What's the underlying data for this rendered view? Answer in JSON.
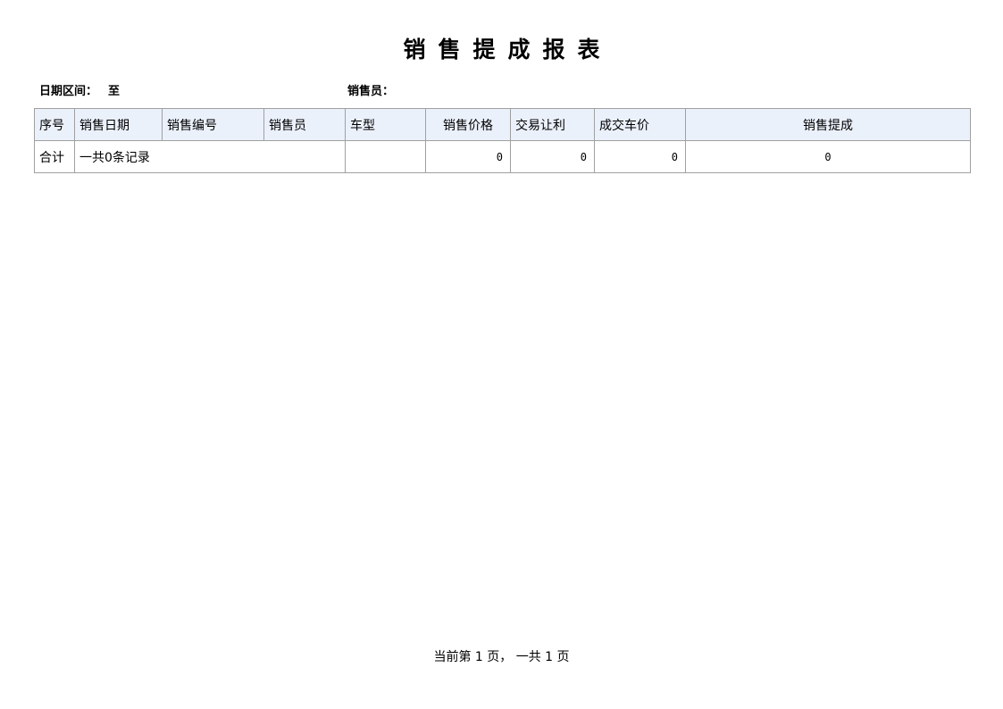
{
  "report": {
    "title": "销售提成报表"
  },
  "filters": {
    "date_range_label": "日期区间：",
    "date_range_separator": "至",
    "salesperson_label": "销售员："
  },
  "table": {
    "headers": [
      "序号",
      "销售日期",
      "销售编号",
      "销售员",
      "车型",
      "销售价格",
      "交易让利",
      "成交车价",
      "销售提成"
    ],
    "total_row": {
      "label": "合计",
      "record_count_text": "一共0条记录",
      "car_model": "",
      "sale_price": "0",
      "discount": "0",
      "final_price": "0",
      "commission": "0"
    }
  },
  "pagination": {
    "text": "当前第 1 页， 一共 1 页"
  }
}
